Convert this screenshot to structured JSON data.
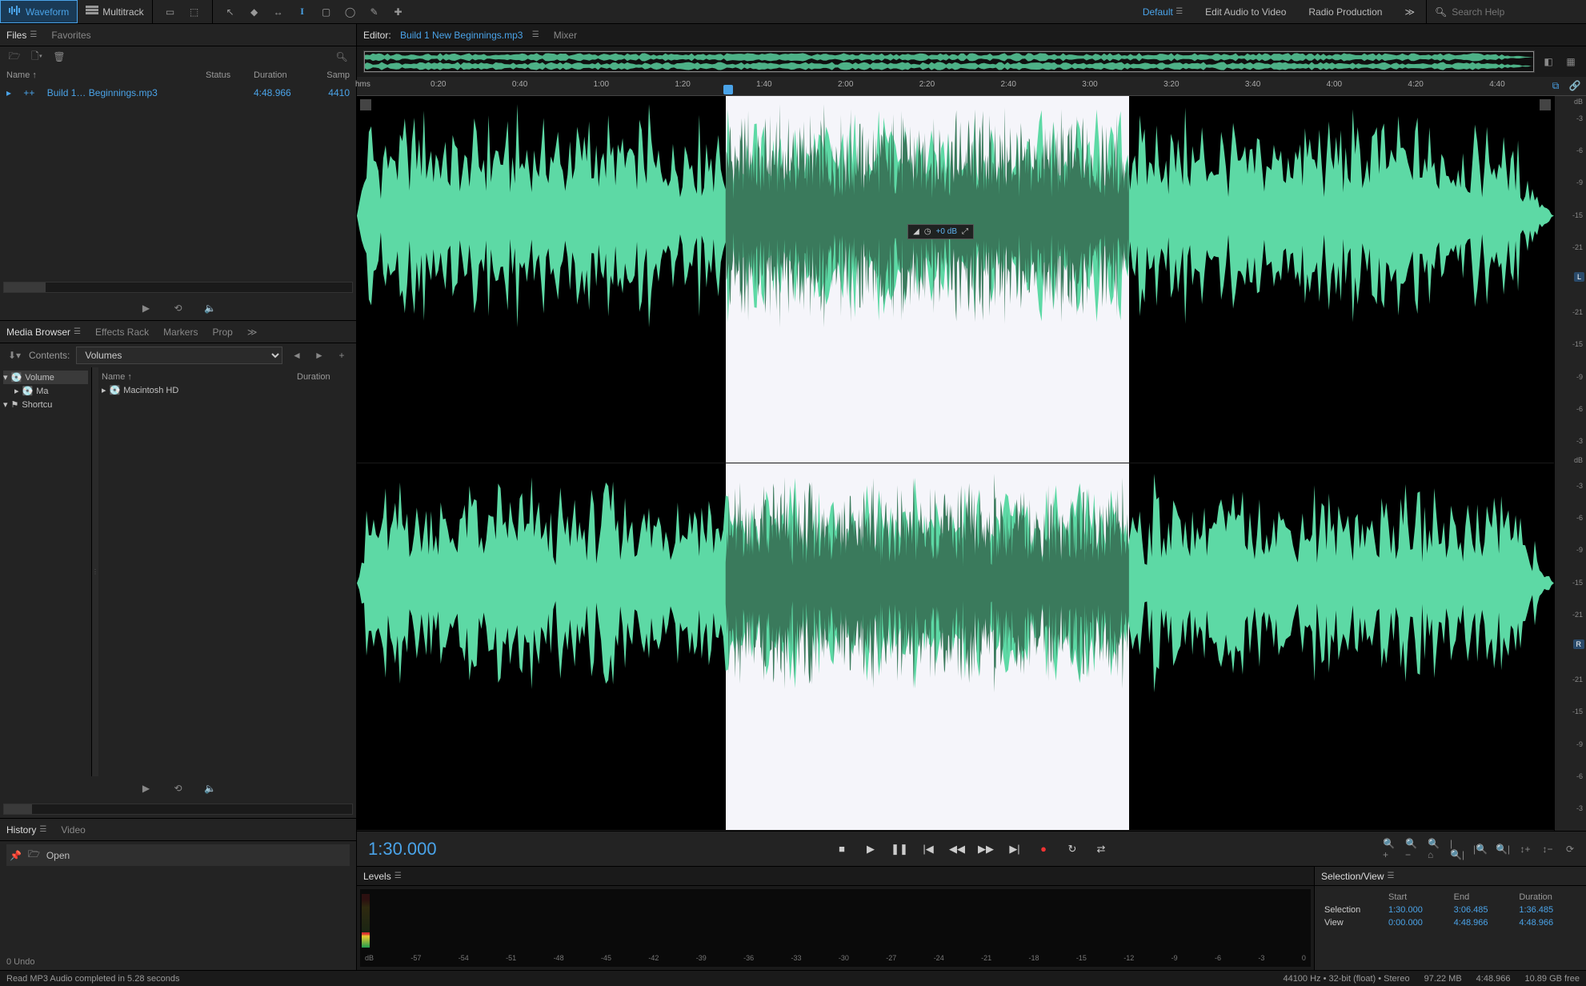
{
  "toolbar": {
    "mode_waveform": "Waveform",
    "mode_multitrack": "Multitrack"
  },
  "workspaces": {
    "default": "Default",
    "edit_av": "Edit Audio to Video",
    "radio": "Radio Production"
  },
  "search": {
    "placeholder": "Search Help"
  },
  "files_panel": {
    "tab_files": "Files",
    "tab_favorites": "Favorites",
    "col_name": "Name",
    "col_status": "Status",
    "col_duration": "Duration",
    "col_samp": "Samp",
    "rows": [
      {
        "name": "Build 1… Beginnings.mp3",
        "duration": "4:48.966",
        "samp": "4410"
      }
    ]
  },
  "browser_panel": {
    "tabs": [
      "Media Browser",
      "Effects Rack",
      "Markers",
      "Properties"
    ],
    "contents_label": "Contents:",
    "contents_value": "Volumes",
    "col_name": "Name",
    "col_duration": "Duration",
    "tree": [
      {
        "label": "Volume",
        "icon": "disk",
        "sel": true
      },
      {
        "label": "Ma",
        "icon": "disk",
        "indent": 1
      },
      {
        "label": "Shortcu",
        "icon": "flag",
        "indent": 0
      }
    ],
    "content_rows": [
      {
        "label": "Macintosh HD",
        "icon": "disk"
      }
    ]
  },
  "history_panel": {
    "tab_history": "History",
    "tab_video": "Video",
    "rows": [
      {
        "label": "Open",
        "icon": "folder"
      }
    ],
    "undo_text": "0 Undo"
  },
  "editor": {
    "tab_editor_prefix": "Editor:",
    "filename": "Build 1 New Beginnings.mp3",
    "tab_mixer": "Mixer",
    "ruler_label": "hms",
    "ruler_ticks": [
      "0:20",
      "0:40",
      "1:00",
      "1:20",
      "1:40",
      "2:00",
      "2:20",
      "2:40",
      "3:00",
      "3:20",
      "3:40",
      "4:00",
      "4:20",
      "4:40"
    ],
    "selection_start_pct": 30.8,
    "selection_end_pct": 64.5,
    "playhead_pct": 31.2,
    "hud_value": "+0 dB",
    "amp_label": "dB",
    "amp_ticks": [
      "-3",
      "-6",
      "-9",
      "-15",
      "-21",
      "",
      "-21",
      "-15",
      "-9",
      "-6",
      "-3"
    ],
    "channel_badges": [
      "L",
      "R"
    ]
  },
  "transport": {
    "timecode": "1:30.000"
  },
  "levels": {
    "tab": "Levels",
    "scale": [
      "dB",
      "-57",
      "-54",
      "-51",
      "-48",
      "-45",
      "-42",
      "-39",
      "-36",
      "-33",
      "-30",
      "-27",
      "-24",
      "-21",
      "-18",
      "-15",
      "-12",
      "-9",
      "-6",
      "-3",
      "0"
    ]
  },
  "selview": {
    "title": "Selection/View",
    "col_start": "Start",
    "col_end": "End",
    "col_duration": "Duration",
    "row_sel": "Selection",
    "row_view": "View",
    "sel_start": "1:30.000",
    "sel_end": "3:06.485",
    "sel_dur": "1:36.485",
    "view_start": "0:00.000",
    "view_end": "4:48.966",
    "view_dur": "4:48.966"
  },
  "status": {
    "left": "Read MP3 Audio completed in 5.28 seconds",
    "format": "44100 Hz • 32-bit (float) • Stereo",
    "size": "97.22 MB",
    "dur": "4:48.966",
    "free": "10.89 GB free"
  }
}
